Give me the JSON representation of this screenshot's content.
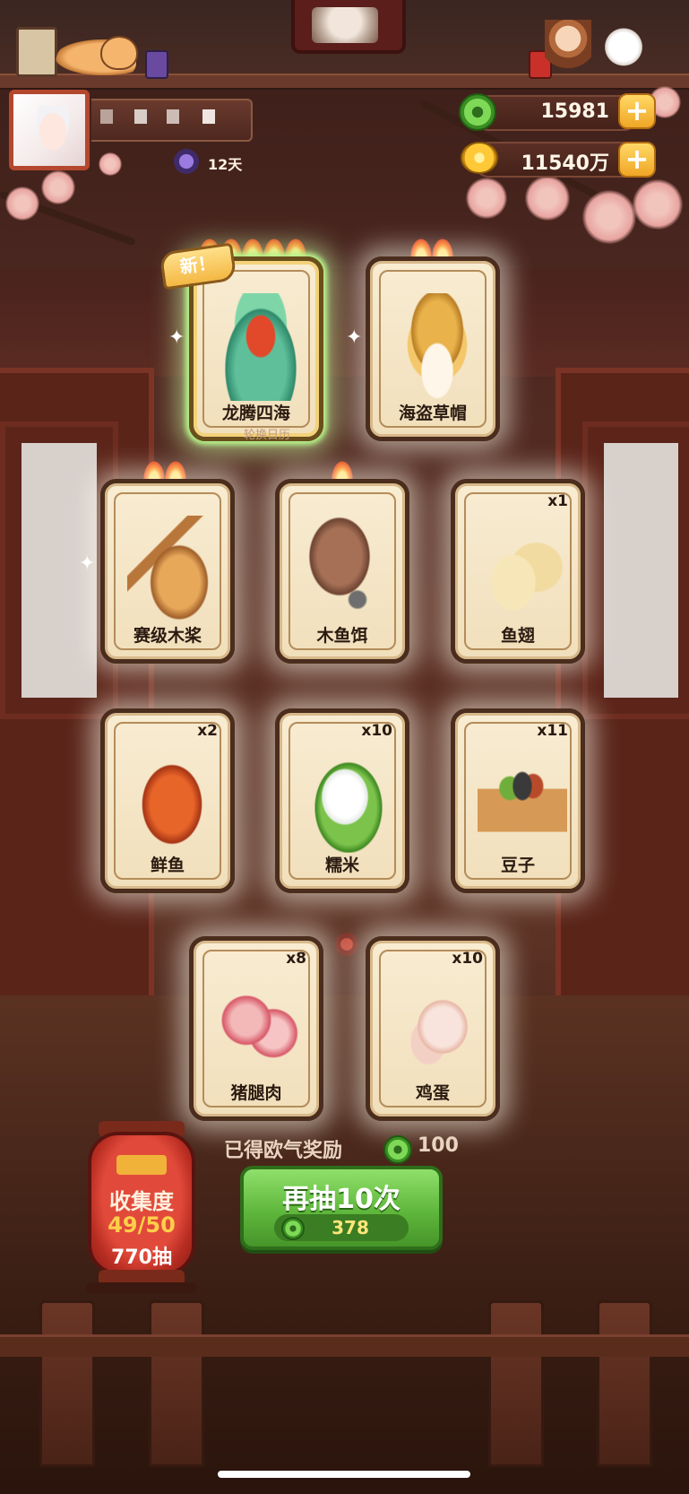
{
  "header": {
    "days": "12天"
  },
  "currency": {
    "gems": "15981",
    "coins": "11540万"
  },
  "banner": {
    "new_tag": "新！",
    "rotate_label": "轮换日历"
  },
  "cards": [
    {
      "name": "龙腾四海",
      "qty": "",
      "flames": 5,
      "art": "dragon-feast-icon",
      "rarity": "gold"
    },
    {
      "name": "海盗草帽",
      "qty": "",
      "flames": 2,
      "art": "straw-hat-icon",
      "rarity": "normal"
    },
    {
      "name": "赛级木桨",
      "qty": "",
      "flames": 2,
      "art": "wooden-paddle-icon",
      "rarity": "normal"
    },
    {
      "name": "木鱼饵",
      "qty": "",
      "flames": 1,
      "art": "wooden-fish-bait-icon",
      "rarity": "normal"
    },
    {
      "name": "鱼翅",
      "qty": "x1",
      "flames": 0,
      "art": "shark-fin-icon",
      "rarity": "normal"
    },
    {
      "name": "鲜鱼",
      "qty": "x2",
      "flames": 0,
      "art": "fresh-fish-icon",
      "rarity": "normal"
    },
    {
      "name": "糯米",
      "qty": "x10",
      "flames": 0,
      "art": "sticky-rice-icon",
      "rarity": "normal"
    },
    {
      "name": "豆子",
      "qty": "x11",
      "flames": 0,
      "art": "beans-box-icon",
      "rarity": "normal"
    },
    {
      "name": "猪腿肉",
      "qty": "x8",
      "flames": 0,
      "art": "pork-leg-icon",
      "rarity": "normal"
    },
    {
      "name": "鸡蛋",
      "qty": "x10",
      "flames": 0,
      "art": "egg-icon",
      "rarity": "normal"
    }
  ],
  "reward": {
    "text": "已得欧气奖励",
    "value": "100"
  },
  "redraw": {
    "label": "再抽10次",
    "cost": "378"
  },
  "collection": {
    "title": "收集度",
    "progress": "49/50",
    "draws": "770抽"
  },
  "colors": {
    "accent_green": "#5fb73c",
    "gold": "#f0a625",
    "card_bg": "#f1dfbb",
    "lantern_red": "#e14a3a"
  }
}
